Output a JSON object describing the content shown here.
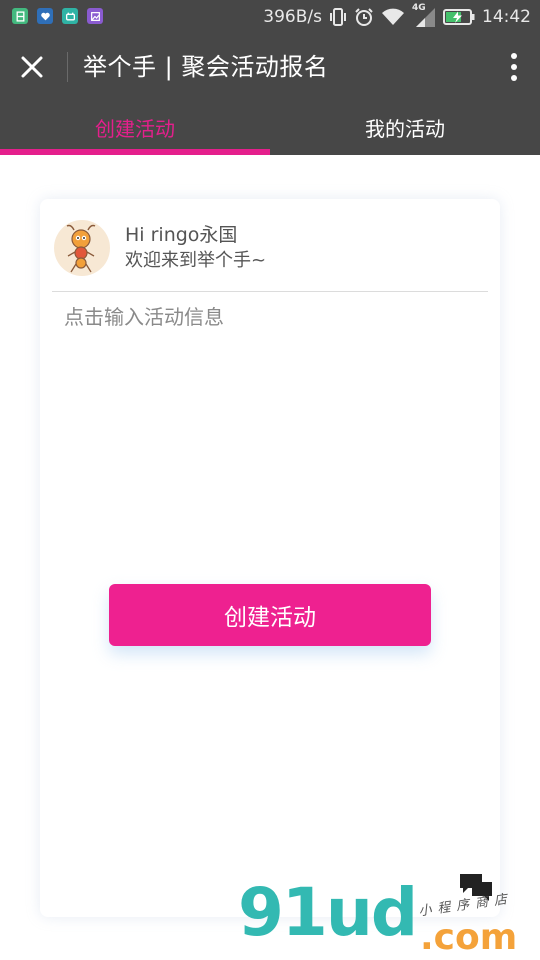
{
  "status_bar": {
    "net_speed": "396B/s",
    "network_type": "4G",
    "time": "14:42",
    "notification_icons": [
      "green-app-icon",
      "blue-heart-icon",
      "teal-app-icon",
      "purple-gallery-icon"
    ]
  },
  "title_bar": {
    "title": "举个手 | 聚会活动报名",
    "close_icon": "close-icon",
    "more_icon": "more-vertical-icon"
  },
  "tabs": [
    {
      "label": "创建活动",
      "active": true
    },
    {
      "label": "我的活动",
      "active": false
    }
  ],
  "colors": {
    "accent": "#e41f8c",
    "button": "#ee2190",
    "header_bg": "#474747"
  },
  "card": {
    "greeting": "Hi ringo永国",
    "welcome": "欢迎来到举个手~",
    "input_placeholder": "点击输入活动信息",
    "input_value": "",
    "create_button_label": "创建活动"
  },
  "watermark": {
    "text": "91ud",
    "domain": ".com",
    "slogan": "小程序商店"
  }
}
